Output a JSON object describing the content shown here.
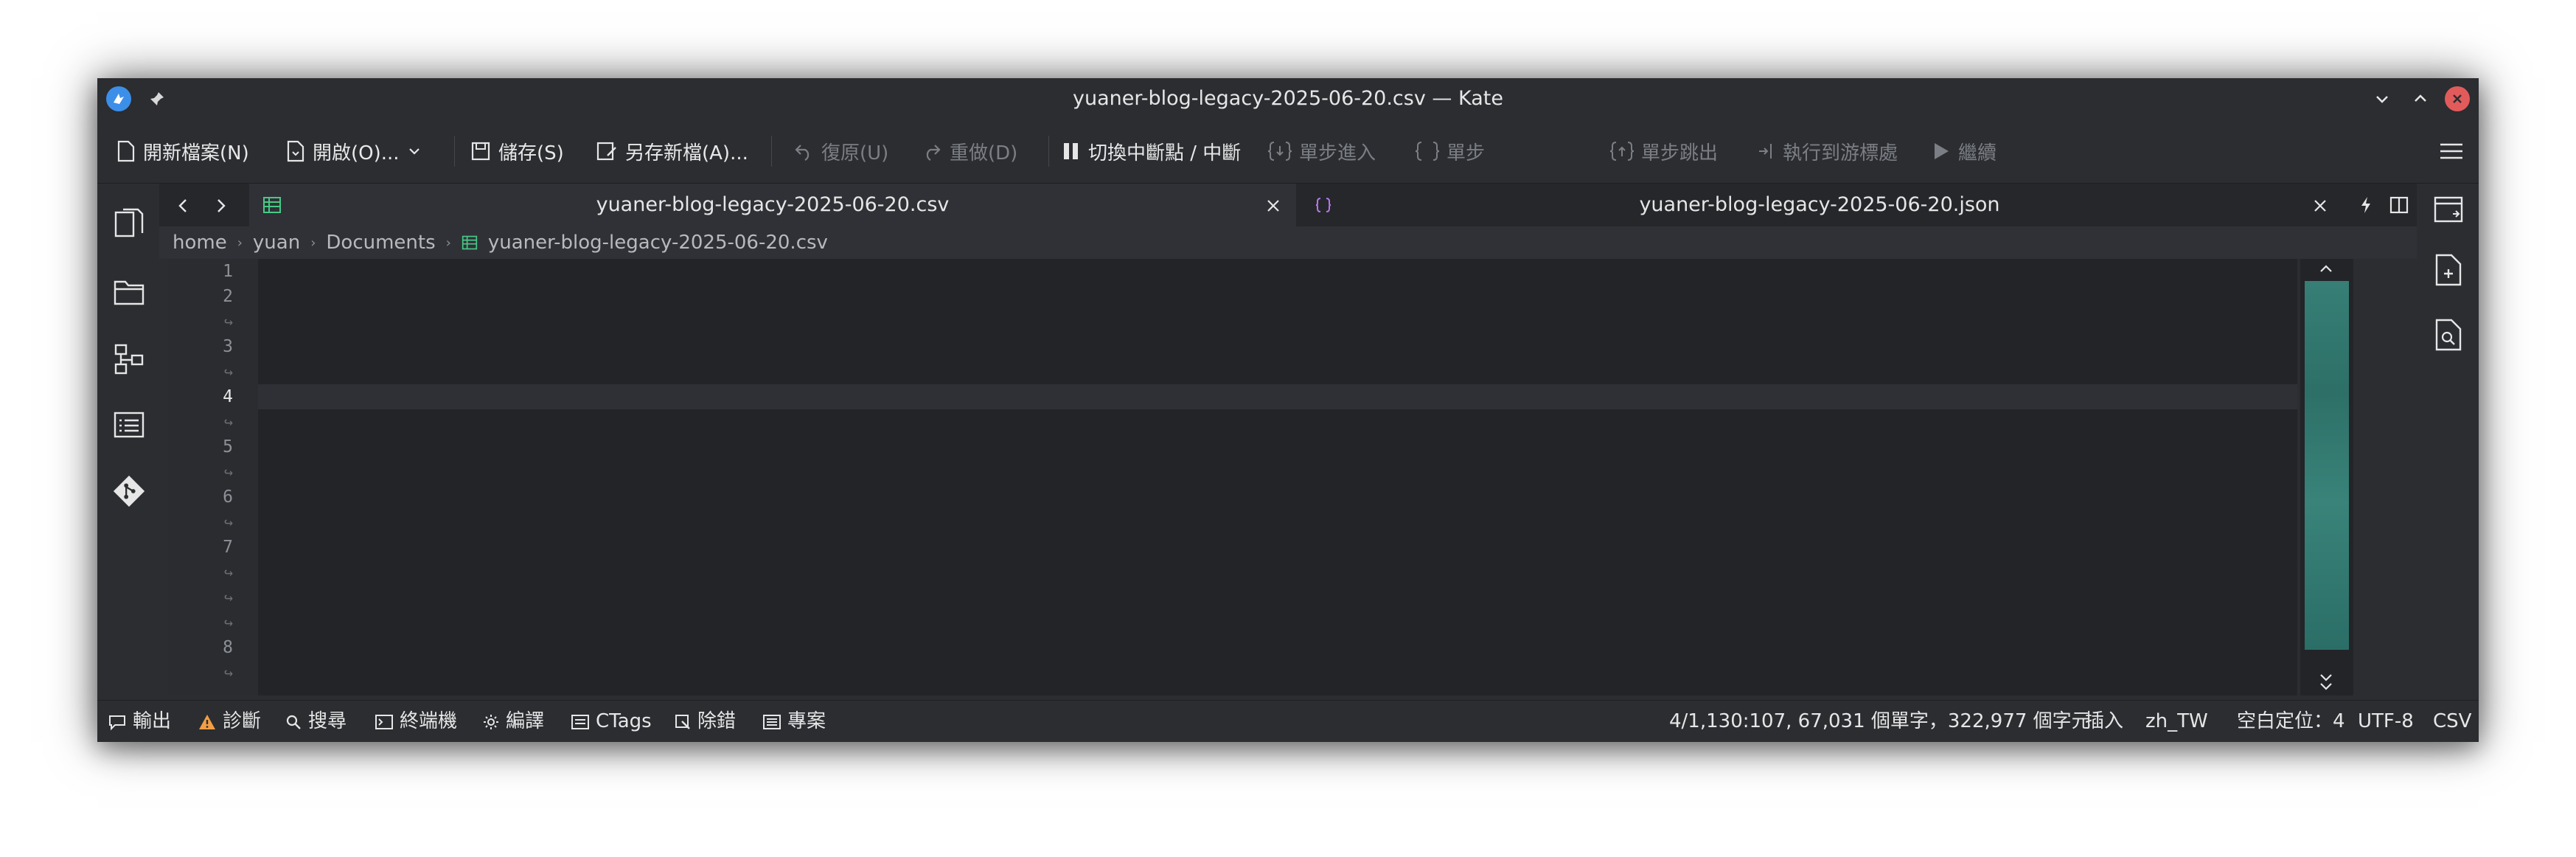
{
  "window": {
    "title": "yuaner-blog-legacy-2025-06-20.csv — Kate"
  },
  "toolbar": {
    "new": "開新檔案(N)",
    "open": "開啟(O)...",
    "save": "儲存(S)",
    "save_as": "另存新檔(A)...",
    "undo": "復原(U)",
    "redo": "重做(D)",
    "toggle_breakpoint": "切換中斷點 / 中斷",
    "step_in": "單步進入",
    "step": "單步",
    "step_out": "單步跳出",
    "run_to_cursor": "執行到游標處",
    "continue": "繼續"
  },
  "tabs": [
    {
      "name": "yuaner-blog-legacy-2025-06-20.csv",
      "active": true
    },
    {
      "name": "yuaner-blog-legacy-2025-06-20.json",
      "active": false
    }
  ],
  "breadcrumb": {
    "home": "home",
    "user": "yuan",
    "folder": "Documents",
    "file": "yuaner-blog-legacy-2025-06-20.csv"
  },
  "editor": {
    "line_numbers": [
      "1",
      "2",
      "3",
      "4",
      "5",
      "6",
      "7",
      "8"
    ],
    "current_line": "4",
    "wrap_marker": "↪"
  },
  "status": {
    "output": "輸出",
    "diagnostics": "診斷",
    "search": "搜尋",
    "terminal": "終端機",
    "build": "編譯",
    "ctags": "CTags",
    "debug": "除錯",
    "project": "專案",
    "position": "4/1,130:107, 67,031 個單字，322,977 個字元",
    "mode": "插入",
    "language": "zh_TW",
    "indent": "空白定位：4",
    "encoding": "UTF-8",
    "filetype": "CSV"
  },
  "colors": {
    "accent": "#3daee9",
    "close": "#e25b5b",
    "keyword_orange": "#f29e45",
    "string_green": "#48c987"
  }
}
